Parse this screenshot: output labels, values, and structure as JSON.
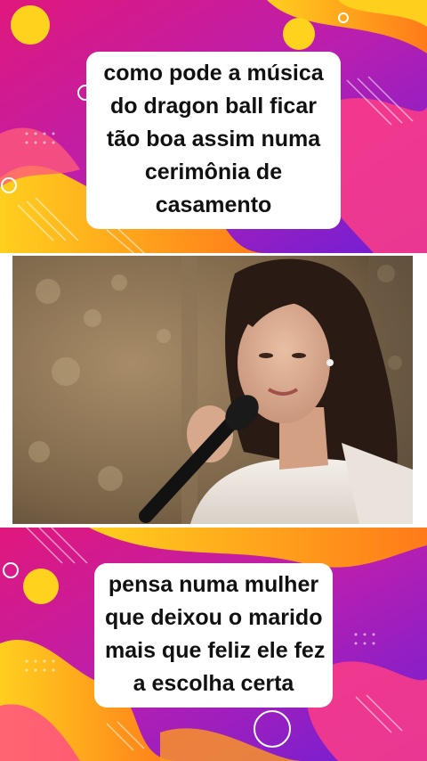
{
  "top_caption": {
    "lines": [
      "como pode a música",
      "do dragon ball ficar",
      "tão boa assim numa",
      "cerimônia de",
      "casamento"
    ]
  },
  "bottom_caption": {
    "lines": [
      "pensa numa mulher",
      "que deixou o marido",
      "mais que feliz ele fez",
      "a escolha certa"
    ]
  },
  "colors": {
    "magenta": "#e0187c",
    "purple": "#7a1fd0",
    "orange": "#ff8a1c",
    "yellow": "#ffd21e",
    "white": "#ffffff"
  },
  "video": {
    "subject": "bride singing into microphone"
  }
}
